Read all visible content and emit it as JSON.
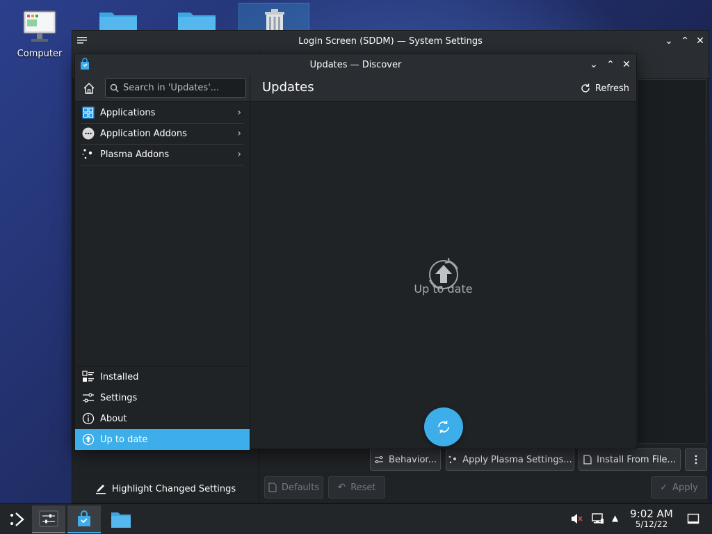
{
  "desktop": {
    "icons": [
      {
        "label": "Computer"
      }
    ]
  },
  "system_settings": {
    "title": "Login Screen (SDDM) — System Settings",
    "buttons": {
      "behavior": "Behavior...",
      "apply_plasma": "Apply Plasma Settings...",
      "install_from_file": "Install From File...",
      "defaults": "Defaults",
      "reset": "Reset",
      "apply": "Apply",
      "highlight": "Highlight Changed Settings"
    }
  },
  "discover": {
    "title": "Updates — Discover",
    "search_placeholder": "Search in 'Updates'...",
    "page_title": "Updates",
    "refresh_label": "Refresh",
    "categories": [
      {
        "label": "Applications"
      },
      {
        "label": "Application Addons"
      },
      {
        "label": "Plasma Addons"
      }
    ],
    "bottom_nav": [
      {
        "label": "Installed"
      },
      {
        "label": "Settings"
      },
      {
        "label": "About"
      },
      {
        "label": "Up to date"
      }
    ],
    "status_message": "Up to date"
  },
  "taskbar": {
    "time": "9:02 AM",
    "date": "5/12/22"
  },
  "colors": {
    "accent": "#3daee9",
    "window_bg": "#202326",
    "header_bg": "#2a2e32"
  }
}
